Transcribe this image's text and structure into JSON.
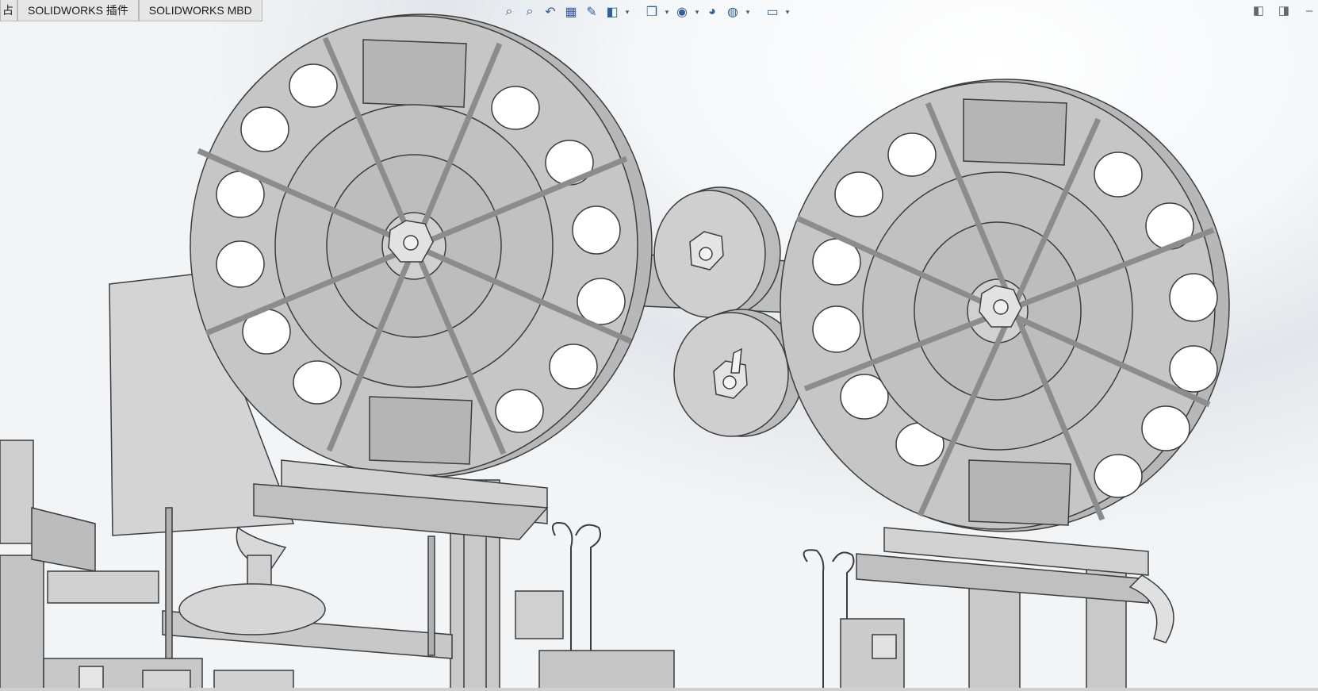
{
  "tabs": [
    {
      "label": "占"
    },
    {
      "label": "SOLIDWORKS 插件"
    },
    {
      "label": "SOLIDWORKS MBD"
    }
  ],
  "heads_up_toolbar": [
    {
      "icon": "zoom-to-fit-icon",
      "glyph": "⌕"
    },
    {
      "icon": "zoom-to-area-icon",
      "glyph": "⌕"
    },
    {
      "icon": "previous-view-icon",
      "glyph": "↶"
    },
    {
      "icon": "section-view-icon",
      "glyph": "▦"
    },
    {
      "icon": "dynamic-annotation-icon",
      "glyph": "✎"
    },
    {
      "icon": "view-orientation-icon",
      "glyph": "◧"
    },
    {
      "icon": "display-style-icon",
      "glyph": "❒"
    },
    {
      "icon": "hide-show-items-icon",
      "glyph": "◉"
    },
    {
      "icon": "edit-appearance-icon",
      "glyph": "◕"
    },
    {
      "icon": "apply-scene-icon",
      "glyph": "◍"
    },
    {
      "icon": "view-settings-icon",
      "glyph": "▭"
    }
  ],
  "window_controls": [
    {
      "icon": "collapse-left-panel-icon",
      "glyph": "◧"
    },
    {
      "icon": "collapse-right-panel-icon",
      "glyph": "◨"
    },
    {
      "icon": "minimize-icon",
      "glyph": "–"
    }
  ],
  "colors": {
    "part_fill": "#c3c3c3",
    "part_edge": "#3c3c3c",
    "part_dark": "#9a9a9a"
  }
}
